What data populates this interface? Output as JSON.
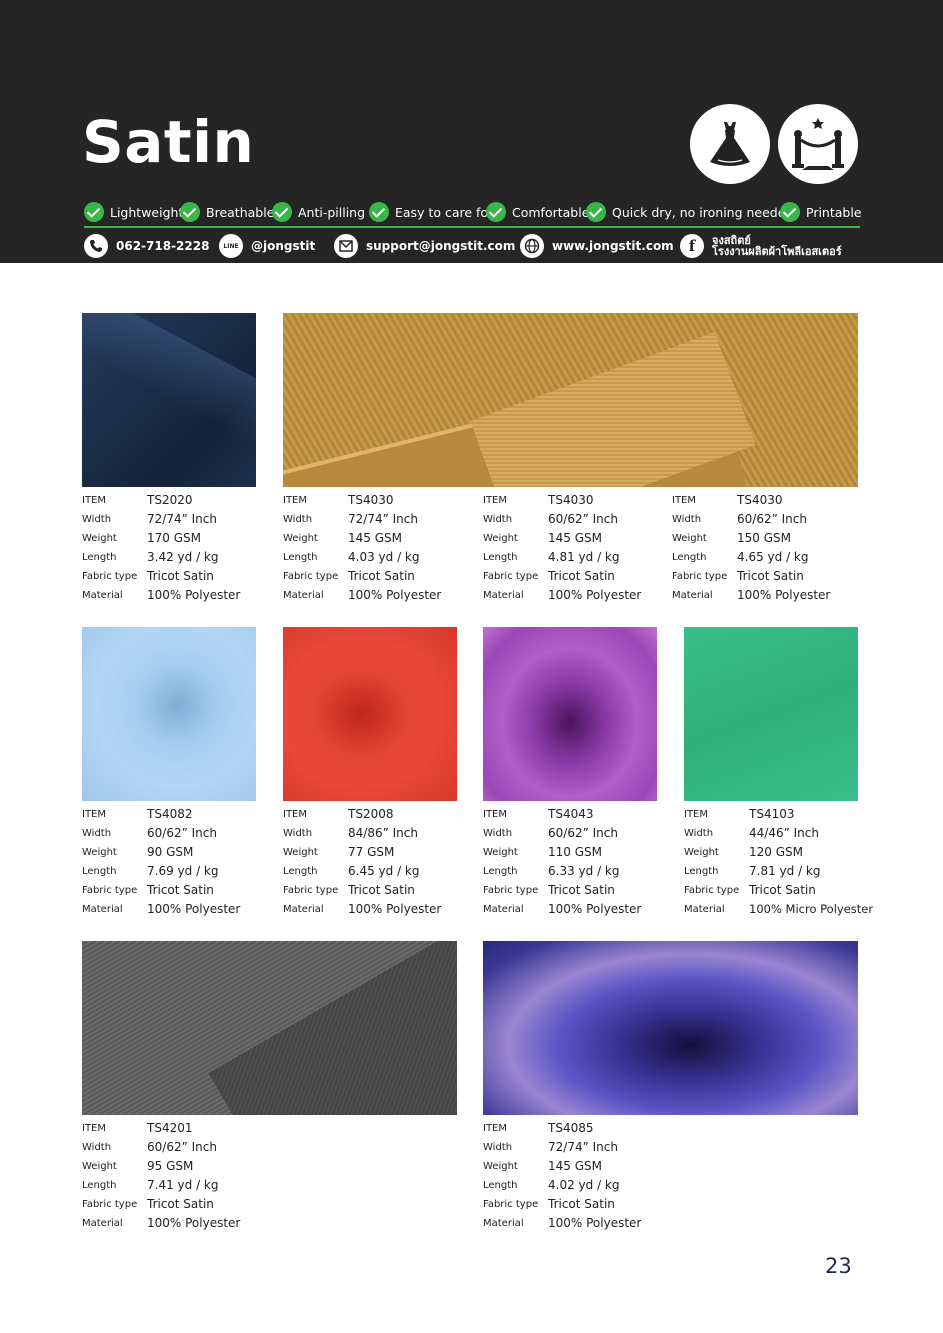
{
  "header": {
    "title": "Satin",
    "features": [
      "Lightweight",
      "Breathable",
      "Anti-pilling",
      "Easy to care for",
      "Comfortable",
      "Quick dry, no ironing needed",
      "Printable"
    ],
    "contacts": {
      "phone": "062-718-2228",
      "line_icon_text": "LINE",
      "line": "@jongstit",
      "email": "support@jongstit.com",
      "website": "www.jongstit.com",
      "facebook_line1": "จงสถิตย์",
      "facebook_line2": "โรงงานผลิตผ้าโพลีเอสเตอร์"
    },
    "badges": [
      "dress-icon",
      "red-carpet-icon"
    ],
    "colors": {
      "header_bg": "#252525",
      "accent_green": "#39b54a"
    }
  },
  "labels": {
    "item": "ITEM",
    "width": "Width",
    "weight": "Weight",
    "length": "Length",
    "fabric_type": "Fabric type",
    "material": "Material"
  },
  "products": [
    {
      "item": "TS2020",
      "width": "72/74” Inch",
      "weight": "170 GSM",
      "length": "3.42 yd / kg",
      "fabric_type": "Tricot Satin",
      "material": "100% Polyester"
    },
    {
      "item": "TS4030",
      "width": "72/74” Inch",
      "weight": "145 GSM",
      "length": "4.03 yd / kg",
      "fabric_type": "Tricot Satin",
      "material": "100% Polyester"
    },
    {
      "item": "TS4030",
      "width": "60/62” Inch",
      "weight": "145 GSM",
      "length": "4.81 yd / kg",
      "fabric_type": "Tricot Satin",
      "material": "100% Polyester"
    },
    {
      "item": "TS4030",
      "width": "60/62” Inch",
      "weight": "150 GSM",
      "length": "4.65 yd / kg",
      "fabric_type": "Tricot Satin",
      "material": "100% Polyester"
    },
    {
      "item": "TS4082",
      "width": "60/62” Inch",
      "weight": "90 GSM",
      "length": "7.69 yd / kg",
      "fabric_type": "Tricot Satin",
      "material": "100% Polyester"
    },
    {
      "item": "TS2008",
      "width": "84/86” Inch",
      "weight": "77 GSM",
      "length": "6.45 yd / kg",
      "fabric_type": "Tricot Satin",
      "material": "100% Polyester"
    },
    {
      "item": "TS4043",
      "width": "60/62” Inch",
      "weight": "110 GSM",
      "length": "6.33 yd / kg",
      "fabric_type": "Tricot Satin",
      "material": "100% Polyester"
    },
    {
      "item": "TS4103",
      "width": "44/46” Inch",
      "weight": "120 GSM",
      "length": "7.81 yd / kg",
      "fabric_type": "Tricot Satin",
      "material": "100% Micro Polyester"
    },
    {
      "item": "TS4201",
      "width": "60/62” Inch",
      "weight": "95 GSM",
      "length": "7.41 yd / kg",
      "fabric_type": "Tricot Satin",
      "material": "100% Polyester"
    },
    {
      "item": "TS4085",
      "width": "72/74” Inch",
      "weight": "145 GSM",
      "length": "4.02 yd / kg",
      "fabric_type": "Tricot Satin",
      "material": "100% Polyester"
    }
  ],
  "swatch_colors": [
    "navy",
    "gold",
    "sky-blue",
    "red",
    "purple",
    "green",
    "grey",
    "indigo"
  ],
  "page_number": "23"
}
